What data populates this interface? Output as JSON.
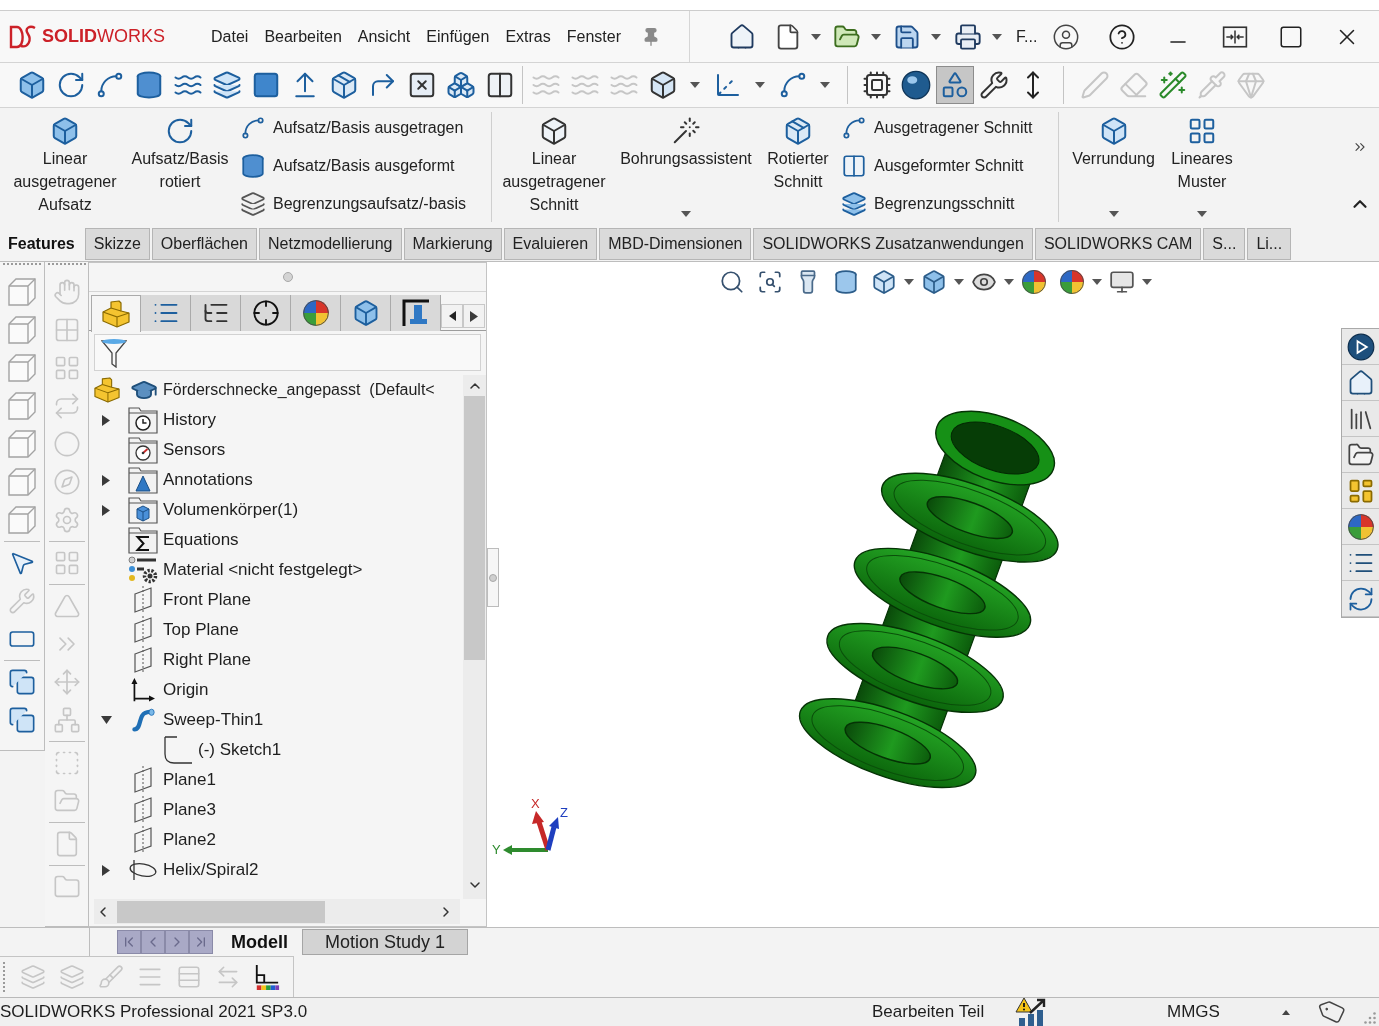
{
  "title_bar": {
    "logo": "**SOLID**WORKS",
    "menu": [
      "Datei",
      "Bearbeiten",
      "Ansicht",
      "Einfügen",
      "Extras",
      "Fenster"
    ],
    "overflow_label": "F..."
  },
  "toolbar": [
    {
      "items": [
        {
          "disabled": false,
          "on": false
        },
        {
          "disabled": false,
          "on": false
        },
        {
          "disabled": false,
          "on": false
        },
        {
          "disabled": false,
          "on": false
        },
        {
          "disabled": false,
          "on": false
        },
        {
          "disabled": false,
          "on": false
        },
        {
          "disabled": false,
          "on": false
        },
        {
          "disabled": false,
          "on": false
        },
        {
          "disabled": false,
          "on": false
        },
        {
          "disabled": false,
          "on": false
        },
        {
          "disabled": false,
          "on": false
        },
        {
          "disabled": false,
          "on": false
        },
        {
          "disabled": false,
          "on": false
        }
      ]
    },
    {
      "items": [
        {
          "disabled": true,
          "on": false
        },
        {
          "disabled": true,
          "on": false
        },
        {
          "disabled": true,
          "on": false
        },
        {
          "disabled": false,
          "on": false
        },
        {
          "disabled": false,
          "on": false
        },
        {
          "disabled": false,
          "on": false
        }
      ]
    },
    {
      "items": [
        {
          "disabled": false,
          "on": false
        },
        {
          "disabled": false,
          "on": false
        },
        {
          "disabled": false,
          "on": true
        },
        {
          "disabled": false,
          "on": false
        },
        {
          "disabled": false,
          "on": false
        }
      ]
    },
    {
      "items": [
        {
          "disabled": true,
          "on": false
        },
        {
          "disabled": true,
          "on": false
        },
        {
          "disabled": false,
          "on": false
        },
        {
          "disabled": true,
          "on": false
        },
        {
          "disabled": true,
          "on": false
        }
      ]
    }
  ],
  "ribbon": [
    {
      "items": [
        {
          "kind": "large",
          "label": "Linear ausgetragener Aufsatz",
          "dropdown": false
        },
        {
          "kind": "large",
          "label": "Aufsatz/Basis rotiert",
          "dropdown": false
        },
        {
          "kind": "stack",
          "items": [
            "Aufsatz/Basis ausgetragen",
            "Aufsatz/Basis ausgeformt",
            "Begrenzungsaufsatz/-basis"
          ]
        }
      ]
    },
    {
      "items": [
        {
          "kind": "large",
          "label": "Linear ausgetragener Schnitt",
          "dropdown": false
        },
        {
          "kind": "large",
          "label": "Bohrungsassistent",
          "dropdown": true
        },
        {
          "kind": "large",
          "label": "Rotierter Schnitt",
          "dropdown": false
        },
        {
          "kind": "stack",
          "items": [
            "Ausgetragener Schnitt",
            "Ausgeformter Schnitt",
            "Begrenzungsschnitt"
          ]
        }
      ]
    },
    {
      "items": [
        {
          "kind": "large",
          "label": "Verrundung",
          "dropdown": true
        },
        {
          "kind": "large",
          "label": "Lineares Muster",
          "dropdown": true
        }
      ]
    }
  ],
  "command_tabs": [
    {
      "label": "Features",
      "selected": true
    },
    {
      "label": "Skizze",
      "selected": false
    },
    {
      "label": "Oberflächen",
      "selected": false
    },
    {
      "label": "Netzmodellierung",
      "selected": false
    },
    {
      "label": "Markierung",
      "selected": false
    },
    {
      "label": "Evaluieren",
      "selected": false
    },
    {
      "label": "MBD-Dimensionen",
      "selected": false
    },
    {
      "label": "SOLIDWORKS Zusatzanwendungen",
      "selected": false
    },
    {
      "label": "SOLIDWORKS CAM",
      "selected": false
    },
    {
      "label": "S...",
      "selected": false
    },
    {
      "label": "Li...",
      "selected": false
    }
  ],
  "left_toolbars": [
    {
      "items": [
        {
          "disabled": false
        },
        {
          "disabled": false
        },
        {
          "disabled": false
        },
        {
          "disabled": false
        },
        {
          "disabled": false
        },
        {
          "disabled": false
        },
        {
          "disabled": false
        },
        {
          "disabled": false
        },
        {
          "disabled": true
        },
        {
          "disabled": false
        },
        {
          "disabled": false
        },
        {
          "disabled": false
        }
      ]
    },
    {
      "items": [
        {
          "disabled": true
        },
        {
          "disabled": true
        },
        {
          "disabled": true
        },
        {
          "disabled": true
        },
        {
          "disabled": true
        },
        {
          "disabled": true
        },
        {
          "disabled": true
        },
        {
          "disabled": true
        },
        {
          "disabled": true
        },
        {
          "disabled": true
        },
        {
          "disabled": true
        },
        {
          "disabled": true
        },
        {
          "disabled": true
        },
        {
          "disabled": true
        },
        {
          "disabled": true
        },
        {
          "disabled": true
        }
      ]
    }
  ],
  "panel_tabs": [
    {
      "selected": true
    },
    {
      "selected": false
    },
    {
      "selected": false
    },
    {
      "selected": false
    },
    {
      "selected": false
    },
    {
      "selected": false
    },
    {
      "selected": false
    }
  ],
  "tree": {
    "root": {
      "label": "Förderschnecke_angepasst  (Default<"
    },
    "items": [
      {
        "kind": "history",
        "label": "History",
        "expanded": false
      },
      {
        "kind": "sensors",
        "label": "Sensors"
      },
      {
        "kind": "annotations",
        "label": "Annotations",
        "expanded": false
      },
      {
        "kind": "bodies",
        "label": "Volumenkörper(1)",
        "expanded": false
      },
      {
        "kind": "equations",
        "label": "Equations"
      },
      {
        "kind": "material",
        "label": "Material <nicht festgelegt>"
      },
      {
        "kind": "plane",
        "label": "Front Plane"
      },
      {
        "kind": "plane",
        "label": "Top Plane"
      },
      {
        "kind": "plane",
        "label": "Right Plane"
      },
      {
        "kind": "origin",
        "label": "Origin"
      },
      {
        "kind": "sweep",
        "label": "Sweep-Thin1",
        "expanded": true,
        "children": [
          {
            "kind": "sketch",
            "label": "(-) Sketch1"
          }
        ]
      },
      {
        "kind": "plane",
        "label": "Plane1"
      },
      {
        "kind": "plane",
        "label": "Plane3"
      },
      {
        "kind": "plane",
        "label": "Plane2"
      },
      {
        "kind": "helix",
        "label": "Helix/Spiral2",
        "expanded": false
      }
    ]
  },
  "bottom_tabs": [
    {
      "label": "Modell",
      "selected": true
    },
    {
      "label": "Motion Study 1",
      "selected": false
    }
  ],
  "bottom_toolbar": [
    {
      "disabled": true
    },
    {
      "disabled": true
    },
    {
      "disabled": true
    },
    {
      "disabled": true
    },
    {
      "disabled": true
    },
    {
      "disabled": true
    },
    {
      "disabled": false
    }
  ],
  "viewport": {
    "triad": {
      "x": "X",
      "y": "Y",
      "z": "Z"
    }
  },
  "status_bar": {
    "product": "SOLIDWORKS Professional 2021 SP3.0",
    "mode": "Bearbeiten Teil",
    "units": "MMGS"
  }
}
